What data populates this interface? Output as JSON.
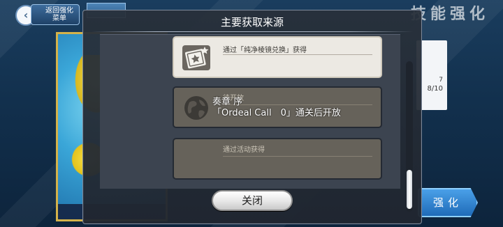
{
  "background": {
    "back_button_label": "返回强化\n菜单",
    "screen_title": "技能强化",
    "enhance_button_label": "强化",
    "right_panel_values": [
      "7",
      "8/10"
    ]
  },
  "modal": {
    "title": "主要获取来源",
    "items": [
      {
        "label": "通过「纯净棱镜兑换」获得",
        "icon": "star-card-icon",
        "state": "active"
      },
      {
        "label": "待开放",
        "icon": "globe-icon",
        "state": "locked"
      },
      {
        "label": "通过活动获得",
        "icon": "none",
        "state": "locked"
      }
    ],
    "overlay": {
      "line1": "奏章 序",
      "line2": "「Ordeal Call　0」通关后开放"
    },
    "close_button_label": "关闭"
  },
  "colors": {
    "modal_bg": "#2a313c",
    "item_active_bg": "#ece9e3",
    "item_locked_bg": "#66625a",
    "enhance_button": "#1f6bb8"
  }
}
